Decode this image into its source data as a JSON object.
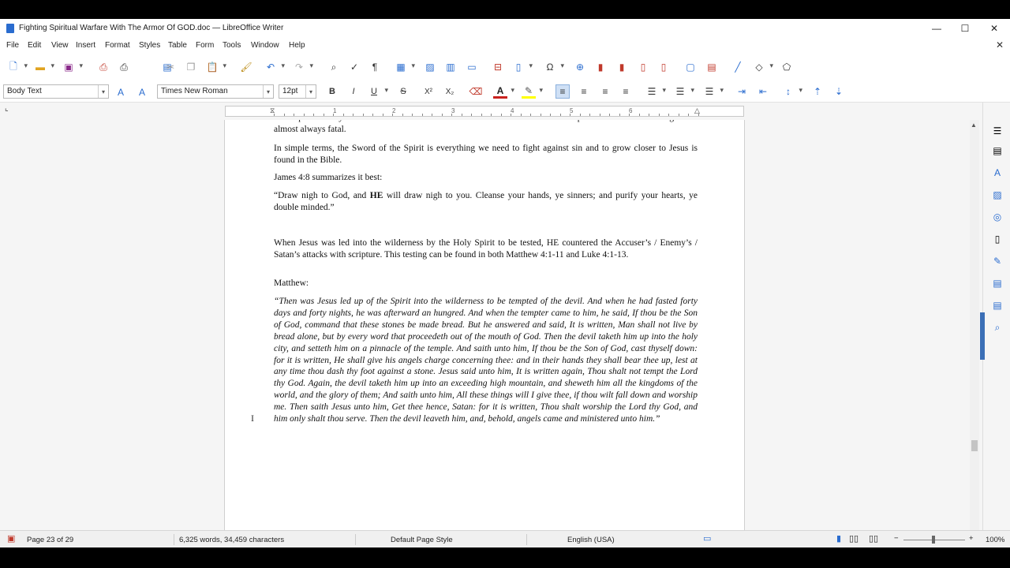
{
  "window": {
    "title": "Fighting Spiritual Warfare With The Armor Of GOD.doc — LibreOffice Writer",
    "minimize": "—",
    "maximize": "☐",
    "close": "✕"
  },
  "menu": [
    "File",
    "Edit",
    "View",
    "Insert",
    "Format",
    "Styles",
    "Table",
    "Form",
    "Tools",
    "Window",
    "Help"
  ],
  "formatting": {
    "paragraph_style": "Body Text",
    "font_name": "Times New Roman",
    "font_size": "12pt",
    "bold": "B",
    "italic": "I",
    "underline": "U",
    "strikethrough": "S",
    "superscript": "X²",
    "subscript": "X₂"
  },
  "ruler": [
    "1",
    "2",
    "3",
    "4",
    "5",
    "6"
  ],
  "document": {
    "p_top": "techniques used by their enemies.  The sword is both a defensive and offensive weapon and the short stabbings were almost always fatal.",
    "p1": "In simple terms, the Sword of the Spirit is everything we need to fight against sin and to grow closer to Jesus is found in the Bible.",
    "p2": "James 4:8 summarizes it best:",
    "p3_a": "“Draw nigh to God, and ",
    "p3_bold": "HE",
    "p3_b": " will draw nigh to you. Cleanse your hands, ye sinners; and purify your hearts, ye double minded.”",
    "p4": "When Jesus was led into the wilderness by the Holy Spirit to be tested, HE countered the Accuser’s / Enemy’s / Satan’s attacks with scripture. This testing can be found in both Matthew 4:1-11 and Luke 4:1-13.",
    "p5": "Matthew:",
    "p6": "“Then was Jesus led up of the Spirit into the wilderness to be tempted of the devil. And when he had fasted forty days and forty nights, he was afterward an hungred. And when the tempter came to him, he said, If thou be the Son of God, command that these stones be made bread. But he answered and said, It is written, Man shall not live by bread alone, but by every word that proceedeth out of the mouth of God. Then the devil taketh him up into the holy city, and setteth him on a pinnacle of the temple.  And saith unto him, If thou be the Son of God, cast thyself down: for it is written, He shall give his angels charge concerning thee: and in their hands they shall bear thee up, lest at any time thou dash thy foot against a stone. Jesus said unto him, It is written again, Thou shalt not tempt the Lord thy God. Again, the devil taketh him up into an exceeding high mountain, and sheweth him all the kingdoms of the world, and the glory of them; And saith unto him, All these things will I give thee, if thou wilt fall down and worship me. Then saith Jesus unto him, Get thee hence, Satan: for it is written, Thou shalt worship the Lord thy God, and him only shalt thou serve. Then the devil leaveth him, and, behold, angels came and ministered unto him.”"
  },
  "status": {
    "page": "Page 23 of 29",
    "words": "6,325 words, 34,459 characters",
    "page_style": "Default Page Style",
    "language": "English (USA)",
    "zoom": "100%"
  },
  "colors": {
    "font_color": "#c9211e",
    "highlight": "#ffff00",
    "accent": "#2a6ccf"
  }
}
